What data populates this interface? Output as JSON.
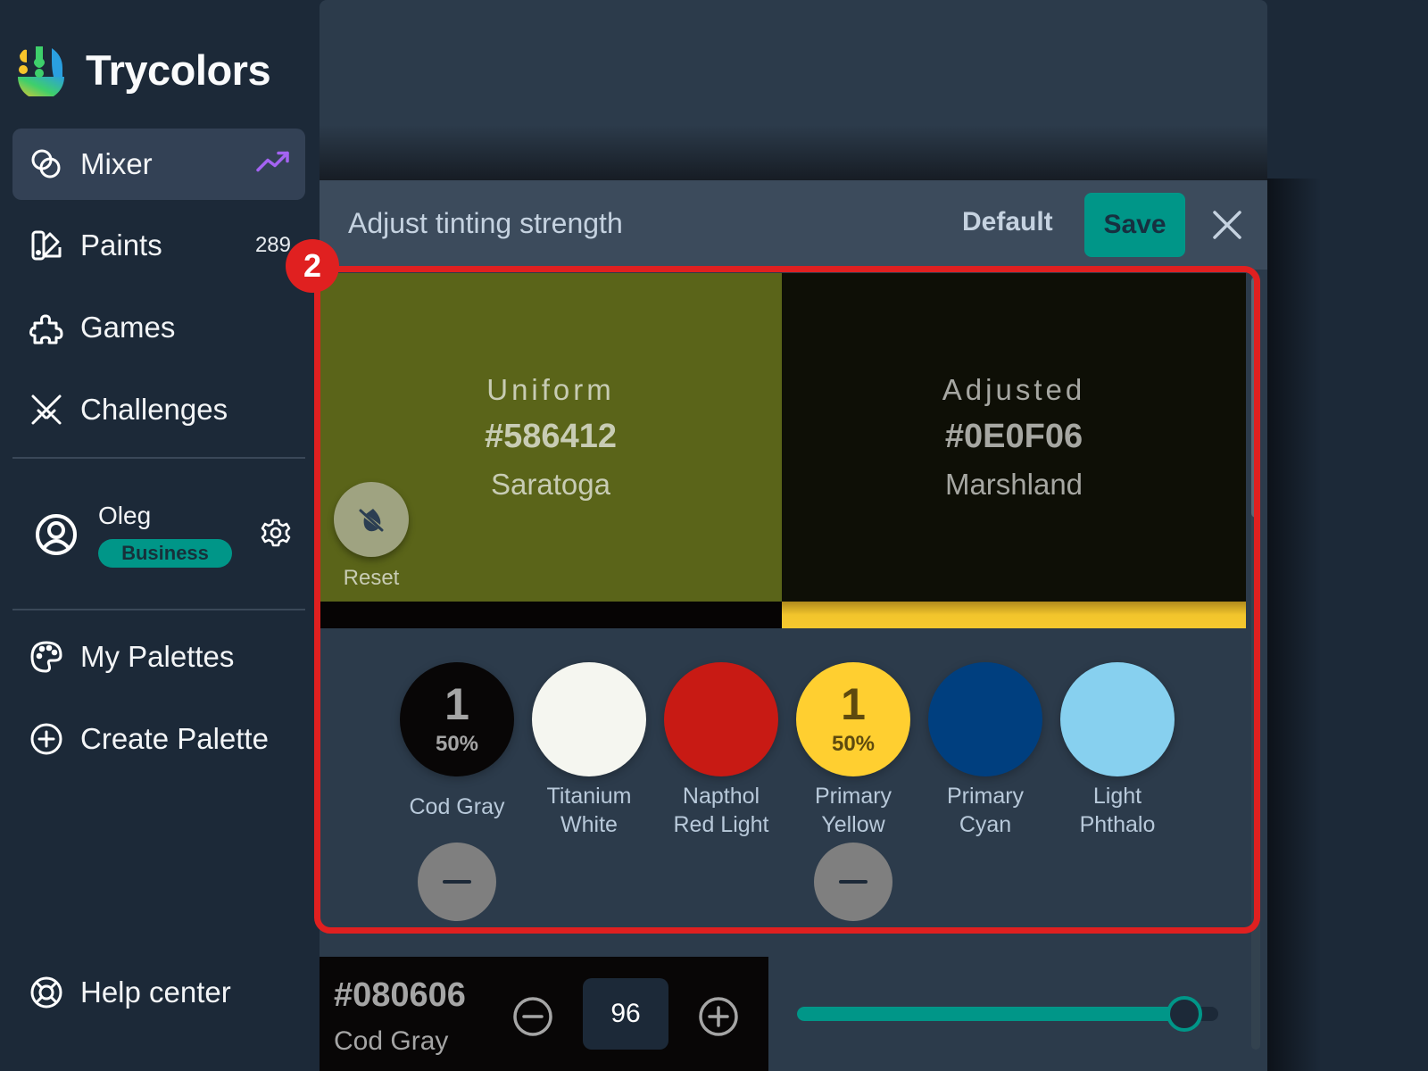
{
  "brand": {
    "name": "Trycolors"
  },
  "sidebar": {
    "items": [
      {
        "label": "Mixer",
        "icon": "mixer-icon",
        "active": true,
        "trail_icon": "trending-up-icon"
      },
      {
        "label": "Paints",
        "icon": "paints-icon",
        "count": "289"
      },
      {
        "label": "Games",
        "icon": "puzzle-icon"
      },
      {
        "label": "Challenges",
        "icon": "swords-icon"
      }
    ],
    "user": {
      "name": "Oleg",
      "plan": "Business"
    },
    "secondary": [
      {
        "label": "My Palettes",
        "icon": "palette-icon"
      },
      {
        "label": "Create Palette",
        "icon": "plus-circle-icon"
      }
    ],
    "help": {
      "label": "Help center",
      "icon": "lifebuoy-icon"
    }
  },
  "modal": {
    "title": "Adjust tinting strength",
    "default_label": "Default",
    "save_label": "Save",
    "uniform": {
      "label": "Uniform",
      "hex": "#586412",
      "name": "Saratoga",
      "color": "#5a6419"
    },
    "adjusted": {
      "label": "Adjusted",
      "hex": "#0E0F06",
      "name": "Marshland",
      "color": "#0e0f06"
    },
    "reset_label": "Reset",
    "paints": [
      {
        "name": "Cod Gray",
        "color": "#080606",
        "count": "1",
        "percent": "50%",
        "text_color": "#a5a5a5",
        "selected": true
      },
      {
        "name": "Titanium White",
        "color": "#f5f6f0"
      },
      {
        "name": "Napthol Red Light",
        "color": "#c81a14"
      },
      {
        "name": "Primary Yellow",
        "color": "#ffcf30",
        "count": "1",
        "percent": "50%",
        "text_color": "#5e4a0e",
        "selected": true
      },
      {
        "name": "Primary Cyan",
        "color": "#003f7f"
      },
      {
        "name": "Light Phthalo",
        "color": "#87d0ef"
      }
    ]
  },
  "editor": {
    "hex": "#080606",
    "name": "Cod Gray",
    "value": "96",
    "slider_fraction": 0.92,
    "accent": "#009688"
  },
  "annotation": {
    "badge": "2"
  }
}
